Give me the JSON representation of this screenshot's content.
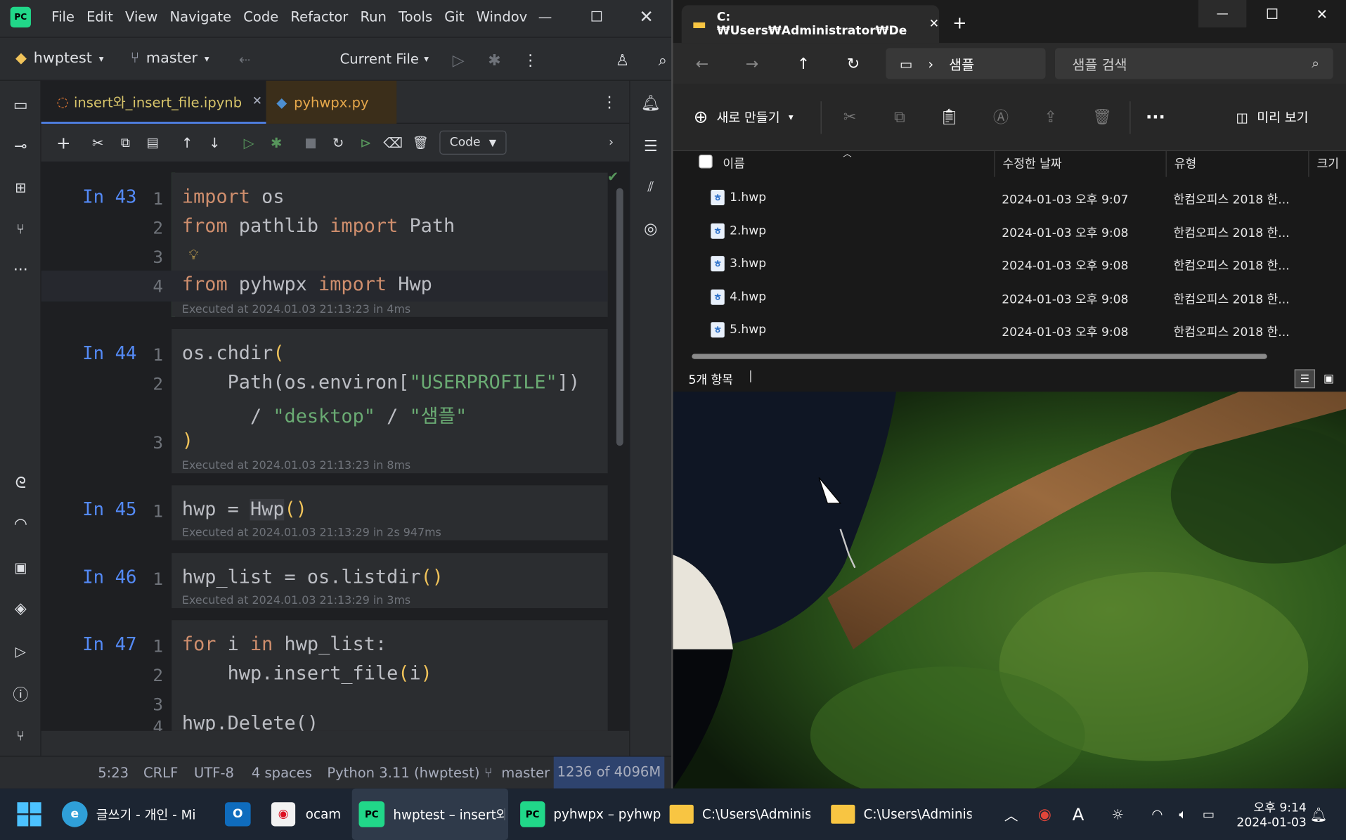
{
  "ide": {
    "menu": [
      "File",
      "Edit",
      "View",
      "Navigate",
      "Code",
      "Refactor",
      "Run",
      "Tools",
      "Git",
      "Windov"
    ],
    "project": "hwptest",
    "branch": "master",
    "run_config": "Current File",
    "tabs": [
      {
        "label": "insert와_insert_file.ipynb",
        "active": true
      },
      {
        "label": "pyhwpx.py",
        "active": false
      }
    ],
    "cell_type": "Code",
    "cells": [
      {
        "label": "In 43",
        "lines": [
          "1",
          "2",
          "3",
          "4"
        ],
        "exec": "Executed at 2024.01.03 21:13:23 in 4ms"
      },
      {
        "label": "In 44",
        "lines": [
          "1",
          "2",
          "",
          "3"
        ],
        "exec": "Executed at 2024.01.03 21:13:23 in 8ms"
      },
      {
        "label": "In 45",
        "lines": [
          "1"
        ],
        "exec": "Executed at 2024.01.03 21:13:29 in 2s 947ms"
      },
      {
        "label": "In 46",
        "lines": [
          "1"
        ],
        "exec": "Executed at 2024.01.03 21:13:29 in 3ms"
      },
      {
        "label": "In 47",
        "lines": [
          "1",
          "2",
          "3",
          "4"
        ],
        "exec": ""
      }
    ],
    "code": {
      "c43_l1": [
        "import",
        " os"
      ],
      "c43_l2": [
        "from",
        " pathlib ",
        "import",
        " Path"
      ],
      "c43_l4": [
        "from",
        " pyhwpx ",
        "import",
        " Hwp"
      ],
      "c44_l1": [
        "os.chdir",
        "("
      ],
      "c44_l2": [
        "    Path(os.environ[",
        "\"USERPROFILE\"",
        "])"
      ],
      "c44_l3": [
        "      / ",
        "\"desktop\"",
        " / ",
        "\"샘플\""
      ],
      "c44_l4": [
        ")"
      ],
      "c45_l1": [
        "hwp = ",
        "Hwp",
        "()"
      ],
      "c46_l1": [
        "hwp_list = os.listdir",
        "()"
      ],
      "c47_l1": [
        "for",
        " i ",
        "in",
        " hwp_list:"
      ],
      "c47_l2": [
        "    hwp.insert_file",
        "(",
        "i",
        ")"
      ],
      "c47_l4": [
        "hwp.Delete()"
      ]
    },
    "status": {
      "pos": "5:23",
      "eol": "CRLF",
      "enc": "UTF-8",
      "indent": "4 spaces",
      "interp": "Python 3.11 (hwptest)",
      "branch": "master",
      "mem": "1236 of 4096M"
    }
  },
  "explorer": {
    "tab_title": "C:₩Users₩Administrator₩De",
    "breadcrumb": "샘플",
    "search_placeholder": "샘플 검색",
    "new_label": "새로 만들기",
    "preview_label": "미리 보기",
    "columns": [
      "이름",
      "수정한 날짜",
      "유형",
      "크기"
    ],
    "files": [
      {
        "name": "1.hwp",
        "date": "2024-01-03 오후 9:07",
        "type": "한컴오피스 2018 한..."
      },
      {
        "name": "2.hwp",
        "date": "2024-01-03 오후 9:08",
        "type": "한컴오피스 2018 한..."
      },
      {
        "name": "3.hwp",
        "date": "2024-01-03 오후 9:08",
        "type": "한컴오피스 2018 한..."
      },
      {
        "name": "4.hwp",
        "date": "2024-01-03 오후 9:08",
        "type": "한컴오피스 2018 한..."
      },
      {
        "name": "5.hwp",
        "date": "2024-01-03 오후 9:08",
        "type": "한컴오피스 2018 한..."
      }
    ],
    "count": "5개 항목"
  },
  "taskbar": {
    "apps": [
      {
        "label": "글쓰기 - 개인 - Mi"
      },
      {
        "label": ""
      },
      {
        "label": "ocam"
      },
      {
        "label": "hwptest – insert와_"
      },
      {
        "label": "pyhwpx – pyhwp"
      },
      {
        "label": "C:\\Users\\Administr"
      },
      {
        "label": "C:\\Users\\Administr"
      }
    ],
    "ime": "A",
    "time": "오후 9:14",
    "date": "2024-01-03"
  },
  "colors": {
    "ide_bg": "#1e1f22",
    "panel": "#2b2d30",
    "keyword": "#cf8e6d",
    "string": "#6aab73",
    "accent": "#548af7",
    "explorer_bg": "#202020",
    "taskbar": "#1c2532"
  }
}
